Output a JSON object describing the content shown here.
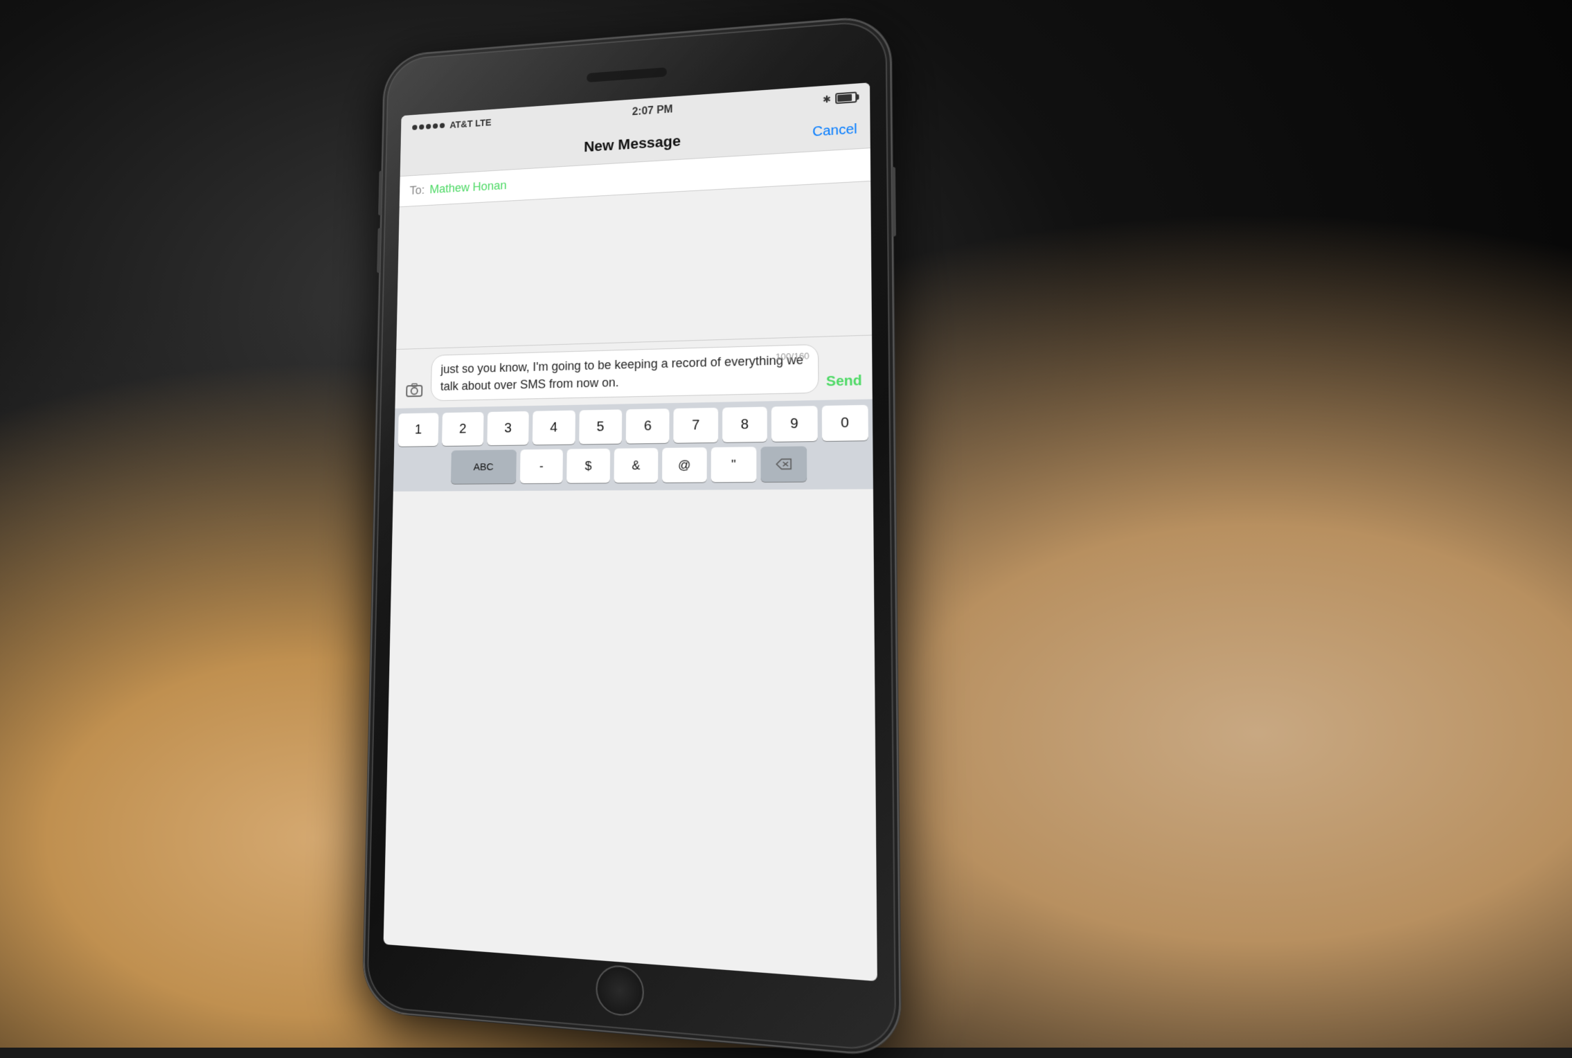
{
  "status_bar": {
    "signal_dots": 5,
    "carrier": "AT&T LTE",
    "time": "2:07 PM",
    "bluetooth": "✱",
    "battery_label": "Battery"
  },
  "nav": {
    "title": "New Message",
    "cancel_label": "Cancel"
  },
  "to_field": {
    "label": "To:",
    "recipient": "Mathew Honan"
  },
  "compose": {
    "message_text": "just so you know, I'm going to be keeping a record of everything we talk about over SMS from now on.",
    "char_count": "100/160",
    "send_label": "Send"
  },
  "keyboard": {
    "row1": [
      "1",
      "2",
      "3",
      "4",
      "5",
      "6",
      "7",
      "8",
      "9",
      "0"
    ],
    "row2": [
      "-",
      "$",
      "&",
      "@",
      "\""
    ],
    "special": {
      "abc": "ABC",
      "delete": "⌫"
    }
  },
  "colors": {
    "accent_green": "#4cd964",
    "accent_blue": "#007aff",
    "bg_dark": "#1a1a1a",
    "screen_bg": "#f0f0f0"
  }
}
